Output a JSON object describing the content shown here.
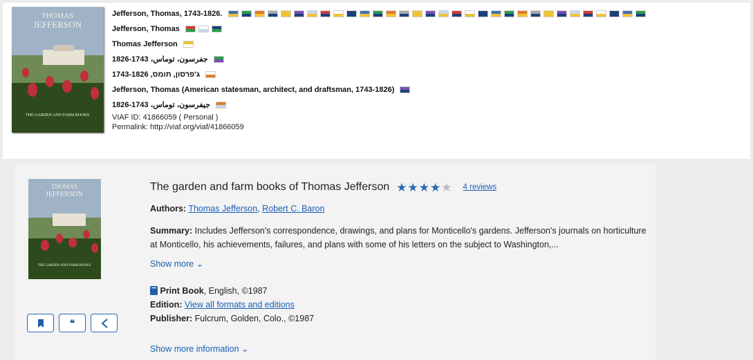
{
  "viaf": {
    "names": [
      {
        "text": "Jefferson, Thomas, 1743-1826.",
        "flags": 32
      },
      {
        "text": "Jefferson, Thomas",
        "flags": 3
      },
      {
        "text": "Thomas Jefferson",
        "flags": 1
      },
      {
        "text": "جفرسون، توماس، 1743-1826",
        "flags": 1
      },
      {
        "text": "ג'פרסון, תומס, 1743-1826",
        "flags": 1
      },
      {
        "text": "Jefferson, Thomas (American statesman, architect, and draftsman, 1743-1826)",
        "flags": 1
      },
      {
        "text": "جيفرسون، توماس، 1743-1826",
        "flags": 1
      }
    ],
    "viaf_id": "VIAF ID: 41866059 ( Personal )",
    "permalink": "Permalink: http://viaf.org/viaf/41866059",
    "cover_lines": [
      "THOMAS",
      "JEFFERSON"
    ],
    "cover_caption": "THE GARDEN AND FARM BOOKS"
  },
  "record": {
    "title": "The garden and farm books of Thomas Jefferson",
    "rating": 4,
    "rating_max": 5,
    "reviews": "4 reviews",
    "authors_label": "Authors:",
    "authors": [
      "Thomas Jefferson",
      "Robert C. Baron"
    ],
    "summary_label": "Summary:",
    "summary": "Includes Jefferson's correspondence, drawings, and plans for Monticello's gardens. Jefferson's journals on horticulture at Monticello, his achievements, failures, and plans with some of his letters on the subject to Washington,...",
    "show_more": "Show more ⌄",
    "format_label": "Print Book",
    "format_rest": ", English, ©1987",
    "edition_label": "Edition:",
    "edition_link": "View all formats and editions",
    "publisher_label": "Publisher:",
    "publisher": "Fulcrum, Golden, Colo., ©1987",
    "show_more_info": "Show more information ⌄",
    "actions": [
      "bookmark",
      "quote",
      "share"
    ]
  },
  "colors": {
    "accent": "#1a5fb4",
    "star_on": "#2a6ab3",
    "star_off": "#bbbbbb"
  }
}
